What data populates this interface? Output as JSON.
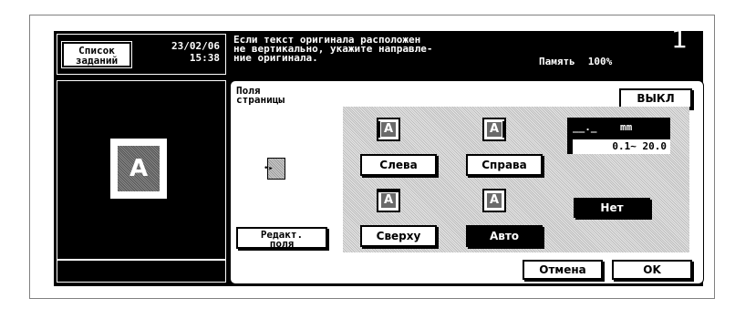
{
  "header": {
    "jobs_button": "Список\nзаданий",
    "date": "23/02/06",
    "time": "15:38",
    "message": "Если текст оригинала расположен\nне вертикально, укажите направле-\nние оригинала.",
    "memory_label": "Память",
    "memory_value": "100%",
    "copies": "1"
  },
  "preview": {
    "icon": "document-a-icon",
    "letter": "A"
  },
  "main": {
    "title": "Поля\nстраницы",
    "off_button": "ВЫКЛ",
    "edit_button": "Редакт.\nполя",
    "options": [
      {
        "label": "Слева",
        "letter": "A"
      },
      {
        "label": "Справа",
        "letter": "A"
      },
      {
        "label": "Сверху",
        "letter": "A"
      },
      {
        "label": "Авто",
        "letter": "A",
        "selected": true
      }
    ],
    "value_display": "__._",
    "unit": "mm",
    "range": "0.1~  20.0",
    "none_button": "Нет",
    "cancel_button": "Отмена",
    "ok_button": "OK"
  }
}
